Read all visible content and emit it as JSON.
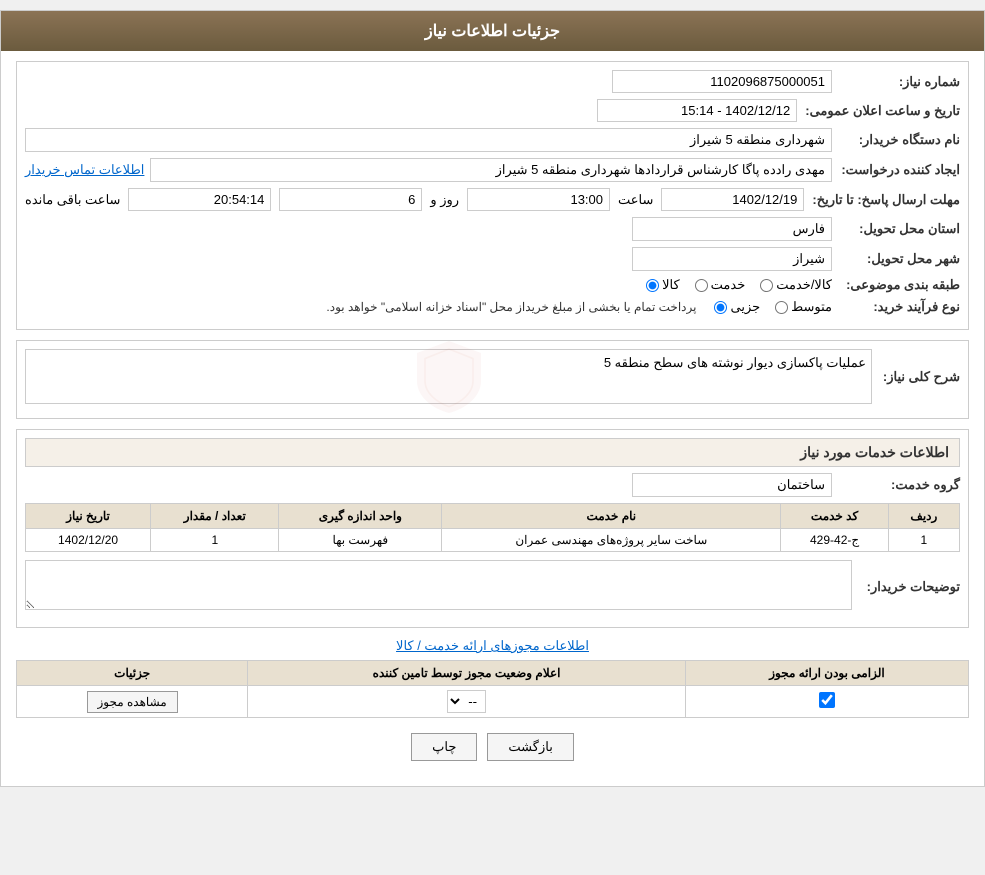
{
  "page": {
    "title": "جزئیات اطلاعات نیاز",
    "sections": {
      "main_info": {
        "need_number_label": "شماره نیاز:",
        "need_number_value": "1102096875000051",
        "date_time_label": "تاریخ و ساعت اعلان عمومی:",
        "date_time_value": "1402/12/12 - 15:14",
        "buyer_org_label": "نام دستگاه خریدار:",
        "buyer_org_value": "شهرداری منطقه 5 شیراز",
        "creator_label": "ایجاد کننده درخواست:",
        "creator_value": "مهدی رادده پاگا کارشناس قراردادها شهرداری منطقه 5 شیراز",
        "buyer_contact_link": "اطلاعات تماس خریدار",
        "deadline_label": "مهلت ارسال پاسخ: تا تاریخ:",
        "deadline_date": "1402/12/19",
        "deadline_time_label": "ساعت",
        "deadline_time": "13:00",
        "deadline_days_label": "روز و",
        "deadline_days": "6",
        "deadline_remaining_label": "ساعت باقی مانده",
        "deadline_remaining": "20:54:14",
        "province_label": "استان محل تحویل:",
        "province_value": "فارس",
        "city_label": "شهر محل تحویل:",
        "city_value": "شیراز",
        "category_label": "طبقه بندی موضوعی:",
        "category_options": [
          "کالا",
          "خدمت",
          "کالا/خدمت"
        ],
        "category_selected": "کالا",
        "purchase_type_label": "نوع فرآیند خرید:",
        "purchase_type_options": [
          "جزیی",
          "متوسط"
        ],
        "purchase_type_note": "پرداخت تمام یا بخشی از مبلغ خریداز محل \"اسناد خزانه اسلامی\" خواهد بود.",
        "purchase_type_selected": "جزیی"
      },
      "need_description": {
        "title": "شرح کلی نیاز:",
        "value": "عملیات پاکسازی دیوار نوشته های سطح منطقه 5"
      },
      "services_section": {
        "title": "اطلاعات خدمات مورد نیاز",
        "service_group_label": "گروه خدمت:",
        "service_group_value": "ساختمان",
        "table": {
          "headers": [
            "ردیف",
            "کد خدمت",
            "نام خدمت",
            "واحد اندازه گیری",
            "تعداد / مقدار",
            "تاریخ نیاز"
          ],
          "rows": [
            {
              "row_num": "1",
              "service_code": "ج-42-429",
              "service_name": "ساخت سایر پروژه‌های مهندسی عمران",
              "unit": "فهرست بها",
              "quantity": "1",
              "need_date": "1402/12/20"
            }
          ]
        }
      },
      "buyer_notes": {
        "title": "توضیحات خریدار:",
        "value": ""
      },
      "permissions": {
        "title": "اطلاعات مجوزهای ارائه خدمت / کالا",
        "table": {
          "headers": [
            "الزامی بودن ارائه مجوز",
            "اعلام وضعیت مجوز توسط تامین کننده",
            "جزئیات"
          ],
          "rows": [
            {
              "required": true,
              "supplier_status": "--",
              "details_btn": "مشاهده مجوز"
            }
          ]
        }
      }
    },
    "buttons": {
      "print": "چاپ",
      "back": "بازگشت"
    }
  }
}
